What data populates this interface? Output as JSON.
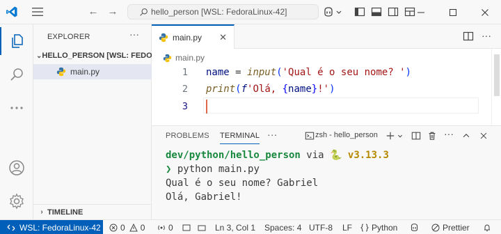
{
  "titlebar": {
    "search_text": "hello_person [WSL: FedoraLinux-42]",
    "icons": [
      "vscode-logo-icon",
      "menu-icon",
      "back-arrow-icon",
      "forward-arrow-icon",
      "search-icon",
      "copilot-icon",
      "toggle-sidebar-icon",
      "toggle-panel-icon",
      "toggle-secondary-sidebar-icon",
      "customize-layout-icon"
    ],
    "window_buttons": [
      "minimize-icon",
      "maximize-icon",
      "close-icon"
    ]
  },
  "activitybar": {
    "items": [
      "explorer-icon",
      "search-icon",
      "more-icon",
      "account-icon",
      "settings-gear-icon"
    ]
  },
  "sidebar": {
    "title": "EXPLORER",
    "more": "···",
    "folder": "HELLO_PERSON [WSL: FEDO...",
    "file": "main.py",
    "timeline": "TIMELINE"
  },
  "editor": {
    "tab_label": "main.py",
    "breadcrumb": "main.py",
    "lines": [
      {
        "num": "1"
      },
      {
        "num": "2"
      },
      {
        "num": "3"
      }
    ],
    "code": {
      "l1_var": "name",
      "l1_eq": " = ",
      "l1_fn": "input",
      "l1_open": "(",
      "l1_str": "'Qual é o seu nome? '",
      "l1_close": ")",
      "l2_fn": "print",
      "l2_open": "(",
      "l2_prefix": "f",
      "l2_str1": "'Olá, ",
      "l2_lbrace": "{",
      "l2_var": "name",
      "l2_rbrace": "}",
      "l2_str2": "!'",
      "l2_close": ")"
    }
  },
  "panel": {
    "tabs": [
      "PROBLEMS",
      "TERMINAL"
    ],
    "more": "···",
    "terminal_name": "zsh - hello_person",
    "terminal": {
      "path": "dev/python/hello_person",
      "via": " via ",
      "py": "🐍 v3.13.3",
      "prompt": "❯",
      "command": " python main.py",
      "out1": "Qual é o seu nome? Gabriel",
      "out2": "Olá, Gabriel!"
    }
  },
  "statusbar": {
    "remote": "WSL: FedoraLinux-42",
    "errors": "0",
    "warnings": "0",
    "ports": "0",
    "position": "Ln 3, Col 1",
    "spaces": "Spaces: 4",
    "encoding": "UTF-8",
    "eol": "LF",
    "language": "Python",
    "prettier": "Prettier"
  },
  "colors": {
    "accent": "#005fb8",
    "cursor": "#e0684b",
    "terminal_path": "#18883e",
    "python_version": "#b58900"
  }
}
